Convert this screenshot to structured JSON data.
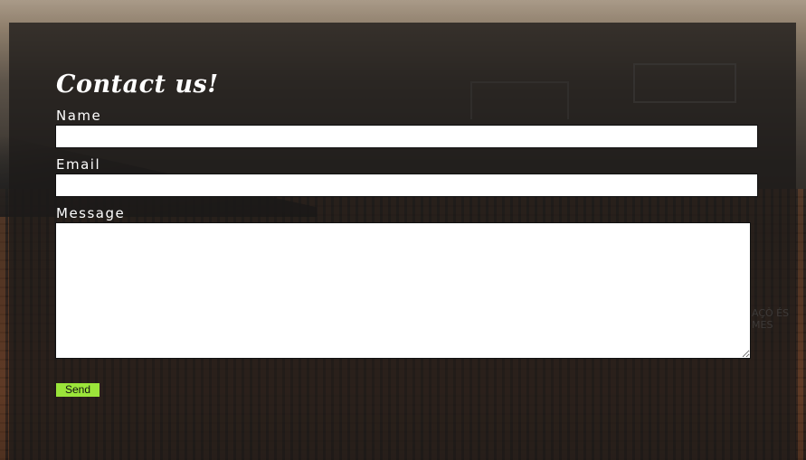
{
  "form": {
    "title": "Contact us!",
    "name_label": "Name",
    "name_value": "",
    "email_label": "Email",
    "email_value": "",
    "message_label": "Message",
    "message_value": "",
    "send_label": "Send"
  },
  "background": {
    "sign_text": "AÇÒ ÉS MES"
  },
  "colors": {
    "panel": "#1c1a18",
    "send_button": "#9be53a",
    "text": "#ffffff"
  }
}
